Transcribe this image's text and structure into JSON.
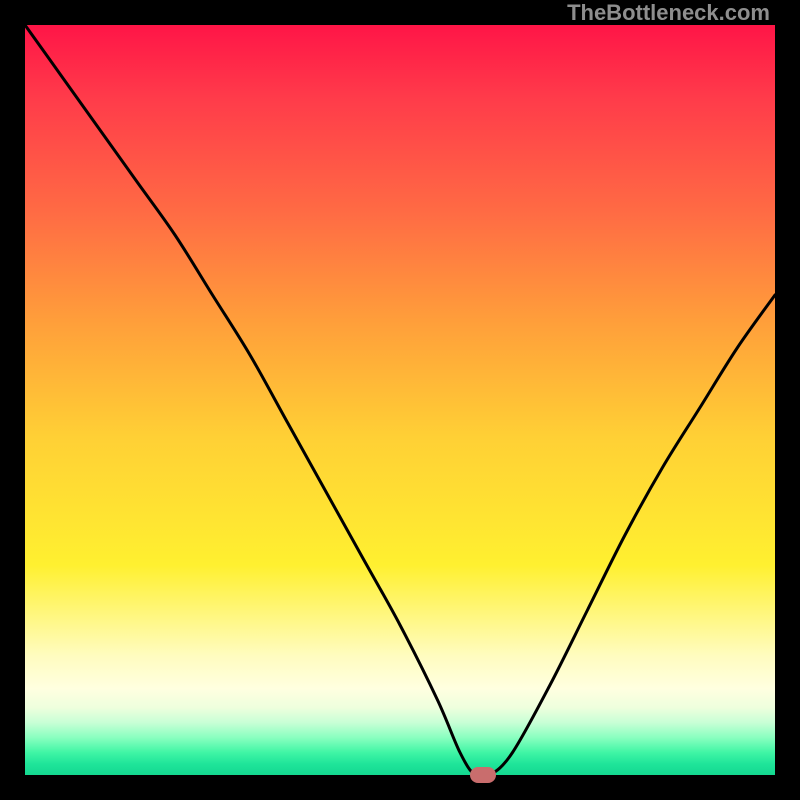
{
  "watermark": "TheBottleneck.com",
  "chart_data": {
    "type": "line",
    "title": "",
    "xlabel": "",
    "ylabel": "",
    "xlim": [
      0,
      100
    ],
    "ylim": [
      0,
      100
    ],
    "x": [
      0,
      5,
      10,
      15,
      20,
      25,
      30,
      35,
      40,
      45,
      50,
      55,
      58,
      60,
      62,
      65,
      70,
      75,
      80,
      85,
      90,
      95,
      100
    ],
    "values": [
      100,
      93,
      86,
      79,
      72,
      64,
      56,
      47,
      38,
      29,
      20,
      10,
      3,
      0,
      0,
      3,
      12,
      22,
      32,
      41,
      49,
      57,
      64
    ],
    "marker": {
      "x": 61,
      "y": 0,
      "color": "#c96d6d"
    },
    "gradient_stops": [
      {
        "pos": 0,
        "color": "#ff1547"
      },
      {
        "pos": 0.1,
        "color": "#ff3c4a"
      },
      {
        "pos": 0.25,
        "color": "#ff6b44"
      },
      {
        "pos": 0.4,
        "color": "#ffa03a"
      },
      {
        "pos": 0.55,
        "color": "#ffd035"
      },
      {
        "pos": 0.72,
        "color": "#fff030"
      },
      {
        "pos": 0.84,
        "color": "#fffcbe"
      },
      {
        "pos": 0.885,
        "color": "#ffffe0"
      },
      {
        "pos": 0.91,
        "color": "#eeffdd"
      },
      {
        "pos": 0.93,
        "color": "#c8ffd6"
      },
      {
        "pos": 0.95,
        "color": "#8affc0"
      },
      {
        "pos": 0.97,
        "color": "#40f5a5"
      },
      {
        "pos": 0.985,
        "color": "#1fe59a"
      },
      {
        "pos": 1.0,
        "color": "#14d890"
      }
    ]
  }
}
